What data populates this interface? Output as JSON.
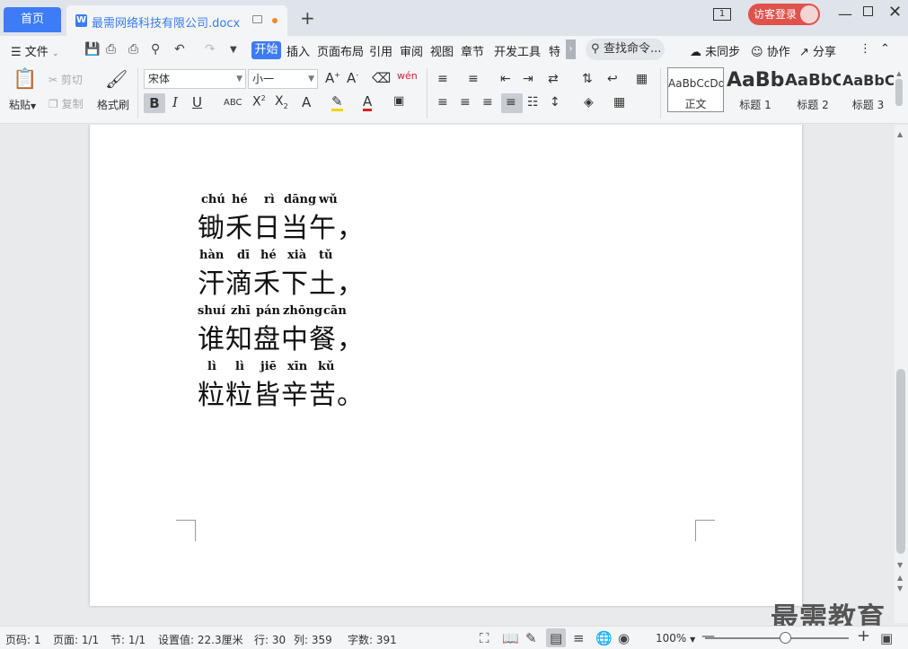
{
  "titlebar": {
    "home_tab": "首页",
    "doc_tab": "最需网络科技有限公司.docx",
    "page_count_badge": "1",
    "login_button": "访客登录"
  },
  "menubar": {
    "file": "文件",
    "tabs": [
      "开始",
      "插入",
      "页面布局",
      "引用",
      "审阅",
      "视图",
      "章节",
      "开发工具",
      "特色"
    ],
    "search": "查找命令...",
    "sync": "未同步",
    "collab": "协作",
    "share": "分享"
  },
  "ribbon": {
    "paste": "粘贴",
    "cut": "剪切",
    "copy": "复制",
    "format_painter": "格式刷",
    "font_name": "宋体",
    "font_size": "小一",
    "styles": [
      {
        "sample": "AaBbCcDd",
        "label": "正文"
      },
      {
        "sample": "AaBb",
        "label": "标题 1"
      },
      {
        "sample": "AaBbC",
        "label": "标题 2"
      },
      {
        "sample": "AaBbC",
        "label": "标题 3"
      }
    ]
  },
  "document": {
    "lines": [
      {
        "pinyin": [
          "chú",
          "hé",
          "rì",
          "dāng",
          "wǔ"
        ],
        "text": "锄禾日当午，"
      },
      {
        "pinyin": [
          "hàn",
          "dī",
          "hé",
          "xià",
          "tǔ"
        ],
        "text": "汗滴禾下土，"
      },
      {
        "pinyin": [
          "shuí",
          "zhī",
          "pán",
          "zhōng",
          "cān"
        ],
        "text": "谁知盘中餐，"
      },
      {
        "pinyin": [
          "lì",
          "lì",
          "jiē",
          "xīn",
          "kǔ"
        ],
        "text": "粒粒皆辛苦。"
      }
    ]
  },
  "statusbar": {
    "page_code": "页码: 1",
    "page": "页面: 1/1",
    "section": "节: 1/1",
    "setting": "设置值: 22.3厘米",
    "row": "行: 30",
    "col": "列: 359",
    "words": "字数: 391",
    "zoom": "100%",
    "zoom_level": 100
  },
  "watermark": "最需教育"
}
